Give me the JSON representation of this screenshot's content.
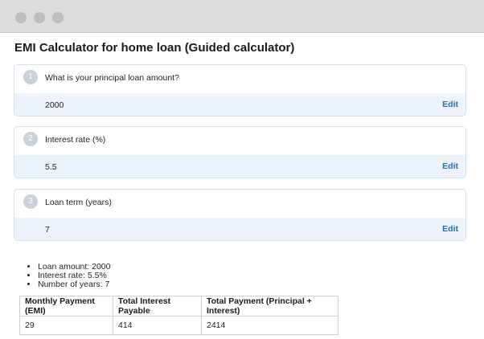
{
  "page": {
    "title": "EMI Calculator for home loan (Guided calculator)"
  },
  "steps": [
    {
      "number": "1",
      "question": "What is your principal loan amount?",
      "value": "2000",
      "edit_label": "Edit"
    },
    {
      "number": "2",
      "question": "Interest rate (%)",
      "value": "5.5",
      "edit_label": "Edit"
    },
    {
      "number": "3",
      "question": "Loan term (years)",
      "value": "7",
      "edit_label": "Edit"
    }
  ],
  "summary": [
    "Loan amount: 2000",
    "Interest rate: 5.5%",
    "Number of years: 7"
  ],
  "results": {
    "headers": [
      "Monthly Payment (EMI)",
      "Total Interest Payable",
      "Total Payment (Principal + Interest)"
    ],
    "rows": [
      [
        "29",
        "414",
        "2414"
      ]
    ]
  },
  "colors": {
    "link": "#1f6fb0",
    "step_body_bg": "#edf3fa",
    "step_border": "#d4e2ee",
    "step_badge": "#c9d2da"
  }
}
